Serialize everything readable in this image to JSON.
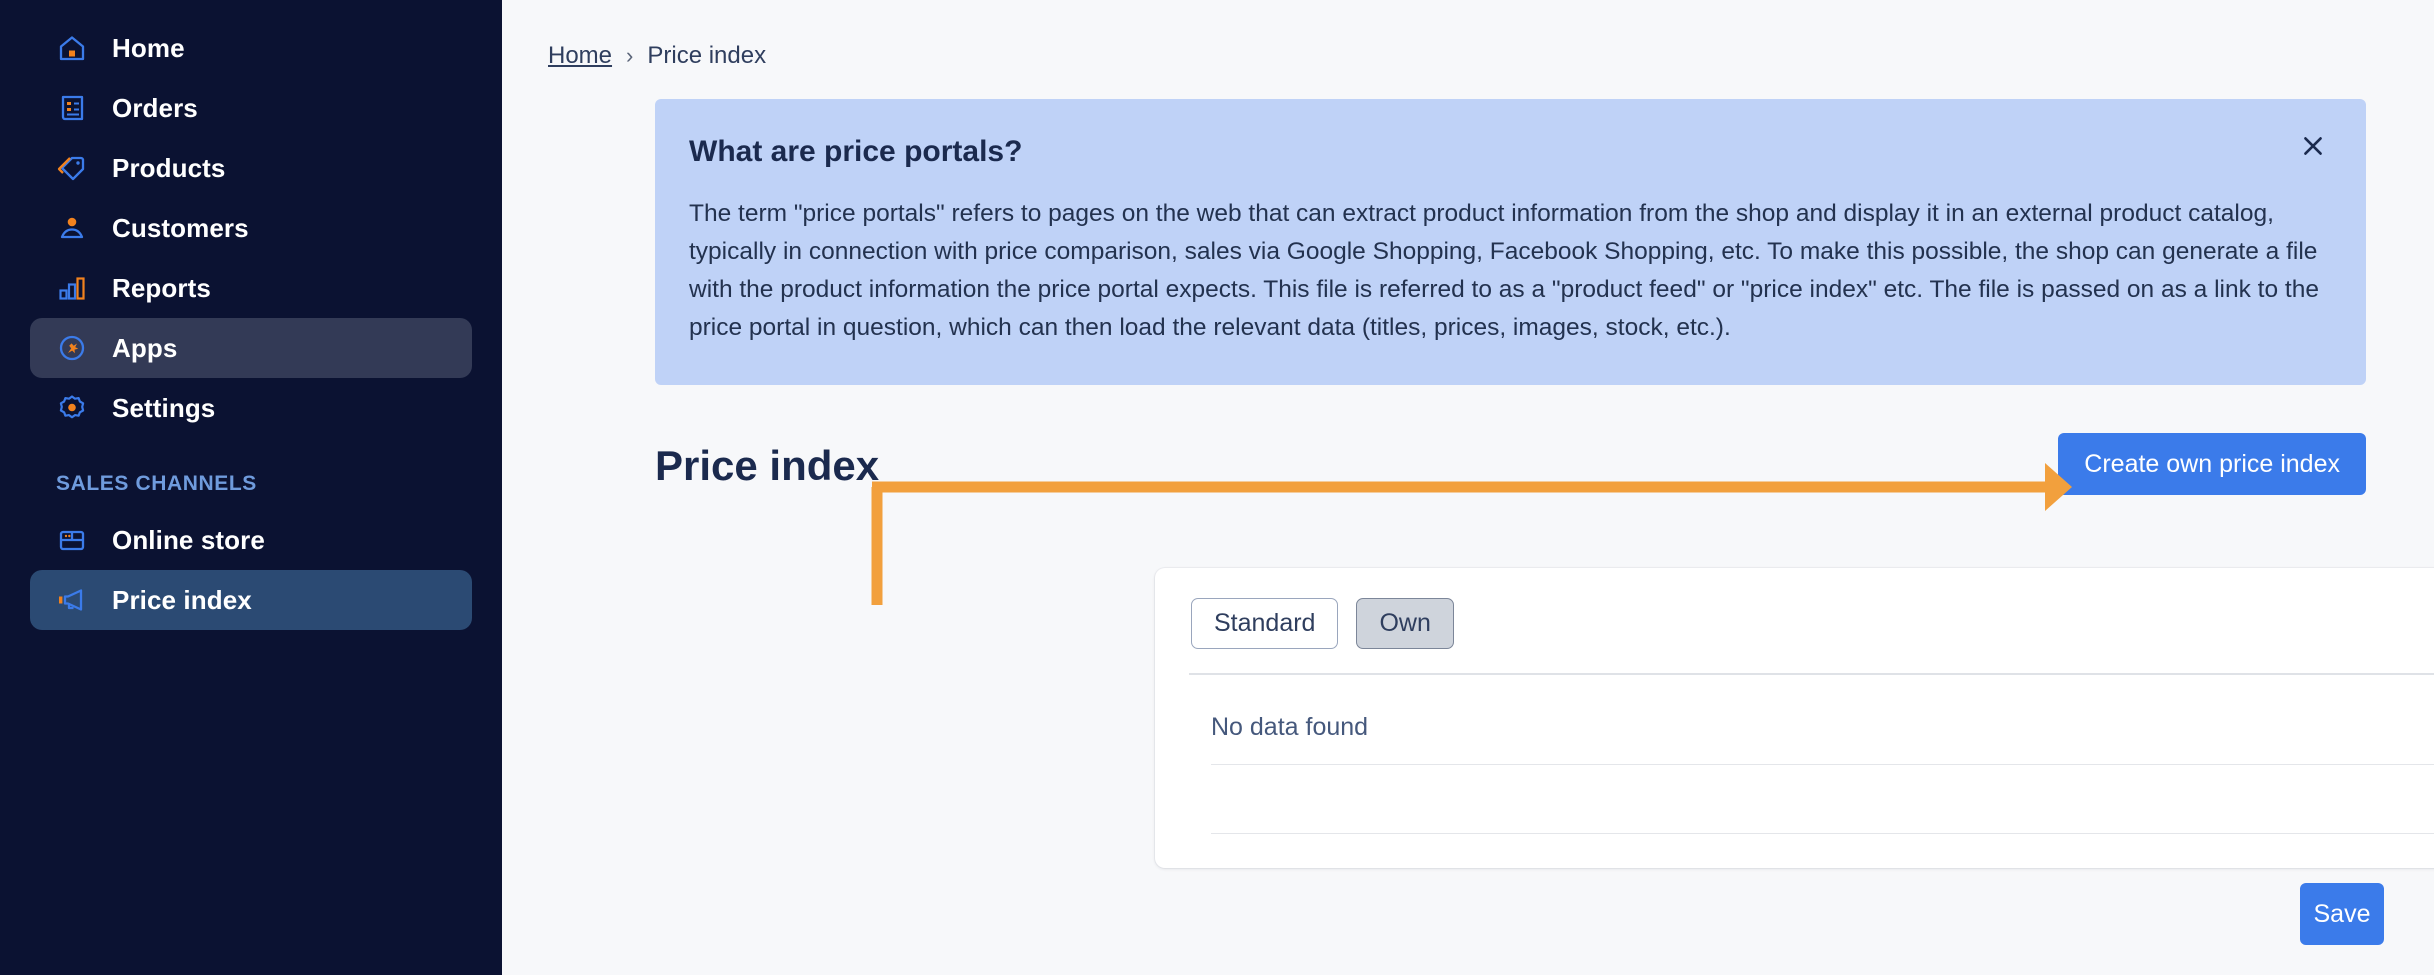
{
  "colors": {
    "sidebar_bg": "#0b1232",
    "sidebar_active_apps": "#333a56",
    "sidebar_active_item": "#2b4a73",
    "icon_blue": "#3b7bea",
    "icon_orange": "#f2821e",
    "accent_blue": "#3b7bea",
    "banner_bg": "#bfd2f7",
    "page_bg": "#f7f8fa",
    "annotation_orange": "#f2a03d",
    "text_dark": "#1b2a4e"
  },
  "sidebar": {
    "items": [
      {
        "label": "Home",
        "icon": "home-icon",
        "active": false
      },
      {
        "label": "Orders",
        "icon": "orders-icon",
        "active": false
      },
      {
        "label": "Products",
        "icon": "products-tag-icon",
        "active": false
      },
      {
        "label": "Customers",
        "icon": "customers-person-icon",
        "active": false
      },
      {
        "label": "Reports",
        "icon": "reports-bar-chart-icon",
        "active": false
      },
      {
        "label": "Apps",
        "icon": "apps-icon",
        "active": true
      },
      {
        "label": "Settings",
        "icon": "settings-gear-icon",
        "active": false
      }
    ],
    "section_label": "SALES CHANNELS",
    "channels": [
      {
        "label": "Online store",
        "icon": "online-store-icon",
        "active": false
      },
      {
        "label": "Price index",
        "icon": "megaphone-icon",
        "active": true
      }
    ]
  },
  "breadcrumb": {
    "home": "Home",
    "separator": "›",
    "current": "Price index"
  },
  "banner": {
    "title": "What are price portals?",
    "body": "The term \"price portals\" refers to pages on the web that can extract product information from the shop and display it in an external product catalog, typically in connection with price comparison, sales via Google Shopping, Facebook Shopping, etc. To make this possible, the shop can generate a file with the product information the price portal expects. This file is referred to as a \"product feed\" or \"price index\" etc. The file is passed on as a link to the price portal in question, which can then load the relevant data (titles, prices, images, stock, etc.).",
    "close_icon": "close-icon"
  },
  "page": {
    "title": "Price index",
    "create_button": "Create own price index",
    "save_button": "Save"
  },
  "card": {
    "tabs": [
      {
        "label": "Standard",
        "selected": false
      },
      {
        "label": "Own",
        "selected": true
      }
    ],
    "empty_message": "No data found"
  },
  "annotation": {
    "type": "arrow",
    "color": "#f2a03d",
    "from": "Own tab",
    "to": "Create own price index button"
  }
}
